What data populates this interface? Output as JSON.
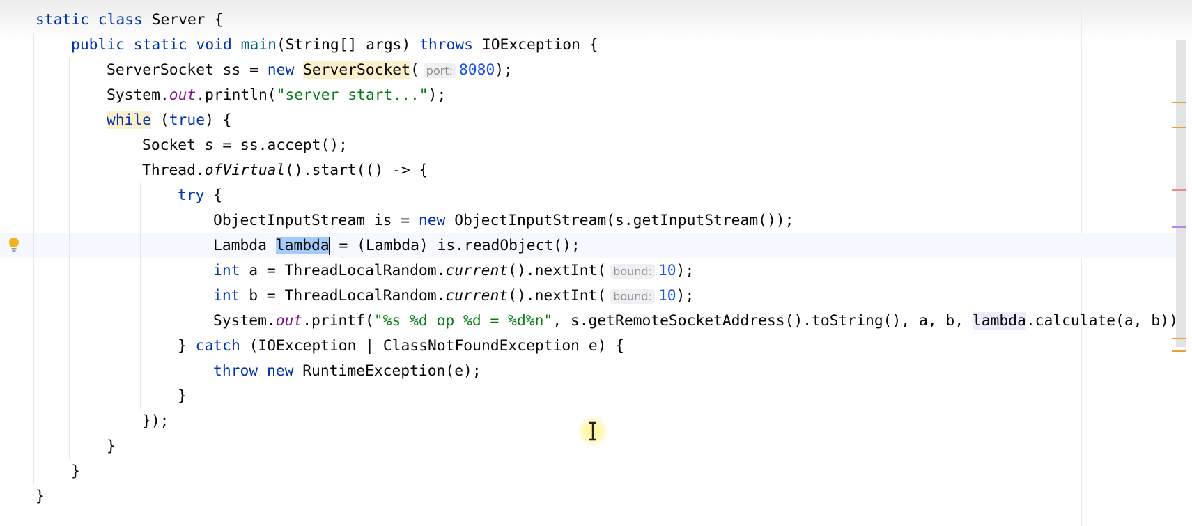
{
  "editor": {
    "current_line": 9,
    "colors": {
      "keyword": "#0033b3",
      "string": "#067d17",
      "number": "#1750eb",
      "static_field": "#871094",
      "selection": "#a6cbf8"
    },
    "lines": [
      {
        "indent": 0,
        "tokens": [
          [
            "static",
            "kw"
          ],
          [
            " ",
            ""
          ],
          [
            "class",
            "kw"
          ],
          [
            " Server {",
            ""
          ]
        ]
      },
      {
        "indent": 1,
        "tokens": [
          [
            "public",
            "kw"
          ],
          [
            " ",
            ""
          ],
          [
            "static",
            "kw"
          ],
          [
            " ",
            ""
          ],
          [
            "void",
            "kw"
          ],
          [
            " ",
            ""
          ],
          [
            "main",
            "fn"
          ],
          [
            "(String[] args) ",
            ""
          ],
          [
            "throws",
            "kw"
          ],
          [
            " IOException {",
            ""
          ]
        ]
      },
      {
        "indent": 2,
        "tokens": [
          [
            "ServerSocket ss = ",
            ""
          ],
          [
            "new",
            "kw"
          ],
          [
            " ",
            ""
          ],
          [
            "ServerSocket",
            "hlw"
          ],
          [
            "(",
            ""
          ],
          [
            "port:",
            "hint"
          ],
          [
            "8080",
            "num"
          ],
          [
            ");",
            ""
          ]
        ]
      },
      {
        "indent": 2,
        "tokens": [
          [
            "System.",
            ""
          ],
          [
            "out",
            "field"
          ],
          [
            ".println(",
            ""
          ],
          [
            "\"server start...\"",
            "str"
          ],
          [
            ");",
            ""
          ]
        ]
      },
      {
        "indent": 2,
        "tokens": [
          [
            "while",
            "hlkw"
          ],
          [
            " (",
            ""
          ],
          [
            "true",
            "kw"
          ],
          [
            ") {",
            ""
          ]
        ]
      },
      {
        "indent": 3,
        "tokens": [
          [
            "Socket s = ss.accept();",
            ""
          ]
        ]
      },
      {
        "indent": 3,
        "tokens": [
          [
            "Thread.",
            ""
          ],
          [
            "ofVirtual",
            "it"
          ],
          [
            "().start(() -> {",
            ""
          ]
        ]
      },
      {
        "indent": 4,
        "tokens": [
          [
            "try",
            "kw"
          ],
          [
            " {",
            ""
          ]
        ]
      },
      {
        "indent": 5,
        "tokens": [
          [
            "ObjectInputStream is = ",
            ""
          ],
          [
            "new",
            "kw"
          ],
          [
            " ObjectInputStream(s.getInputStream());",
            ""
          ]
        ]
      },
      {
        "indent": 5,
        "tokens": [
          [
            "Lambda ",
            ""
          ],
          [
            "lambda",
            "sel"
          ],
          [
            "",
            "caret"
          ],
          [
            " = (Lambda) is.readObject();",
            ""
          ]
        ]
      },
      {
        "indent": 5,
        "tokens": [
          [
            "int",
            "kw"
          ],
          [
            " a = ThreadLocalRandom.",
            ""
          ],
          [
            "current",
            "it"
          ],
          [
            "().nextInt(",
            ""
          ],
          [
            "bound:",
            "hint"
          ],
          [
            "10",
            "num"
          ],
          [
            ");",
            ""
          ]
        ]
      },
      {
        "indent": 5,
        "tokens": [
          [
            "int",
            "kw"
          ],
          [
            " b = ThreadLocalRandom.",
            ""
          ],
          [
            "current",
            "it"
          ],
          [
            "().nextInt(",
            ""
          ],
          [
            "bound:",
            "hint"
          ],
          [
            "10",
            "num"
          ],
          [
            ");",
            ""
          ]
        ]
      },
      {
        "indent": 5,
        "tokens": [
          [
            "System.",
            ""
          ],
          [
            "out",
            "field"
          ],
          [
            ".printf(",
            ""
          ],
          [
            "\"%s %d op %d = %d%n\"",
            "str"
          ],
          [
            ", s.getRemoteSocketAddress().toString(), a, b, ",
            ""
          ],
          [
            "lambda",
            "usage"
          ],
          [
            ".calculate(a, b))",
            ""
          ]
        ]
      },
      {
        "indent": 4,
        "tokens": [
          [
            "} ",
            ""
          ],
          [
            "catch",
            "kw"
          ],
          [
            " (IOException | ClassNotFoundException e) {",
            ""
          ]
        ]
      },
      {
        "indent": 5,
        "tokens": [
          [
            "throw",
            "kw"
          ],
          [
            " ",
            ""
          ],
          [
            "new",
            "kw"
          ],
          [
            " RuntimeException(e);",
            ""
          ]
        ]
      },
      {
        "indent": 4,
        "tokens": [
          [
            "}",
            ""
          ]
        ]
      },
      {
        "indent": 3,
        "tokens": [
          [
            "});",
            ""
          ]
        ]
      },
      {
        "indent": 2,
        "tokens": [
          [
            "}",
            ""
          ]
        ]
      },
      {
        "indent": 1,
        "tokens": [
          [
            "}",
            ""
          ]
        ]
      },
      {
        "indent": 0,
        "tokens": [
          [
            "}",
            ""
          ]
        ]
      }
    ]
  },
  "gutter": {
    "icon": "lightbulb-icon"
  },
  "scrollbar": {
    "markers": [
      {
        "line": 3,
        "color": "#e0a43a"
      },
      {
        "line": 4,
        "color": "#e0a43a"
      },
      {
        "line": 8,
        "color": "#e88a8a"
      },
      {
        "line": 9,
        "color": "#b48ae8"
      },
      {
        "line": 14,
        "color": "#e0a43a"
      },
      {
        "line": 15,
        "color": "#e0a43a"
      }
    ]
  },
  "cursor": {
    "icon": "text-cursor-icon"
  }
}
